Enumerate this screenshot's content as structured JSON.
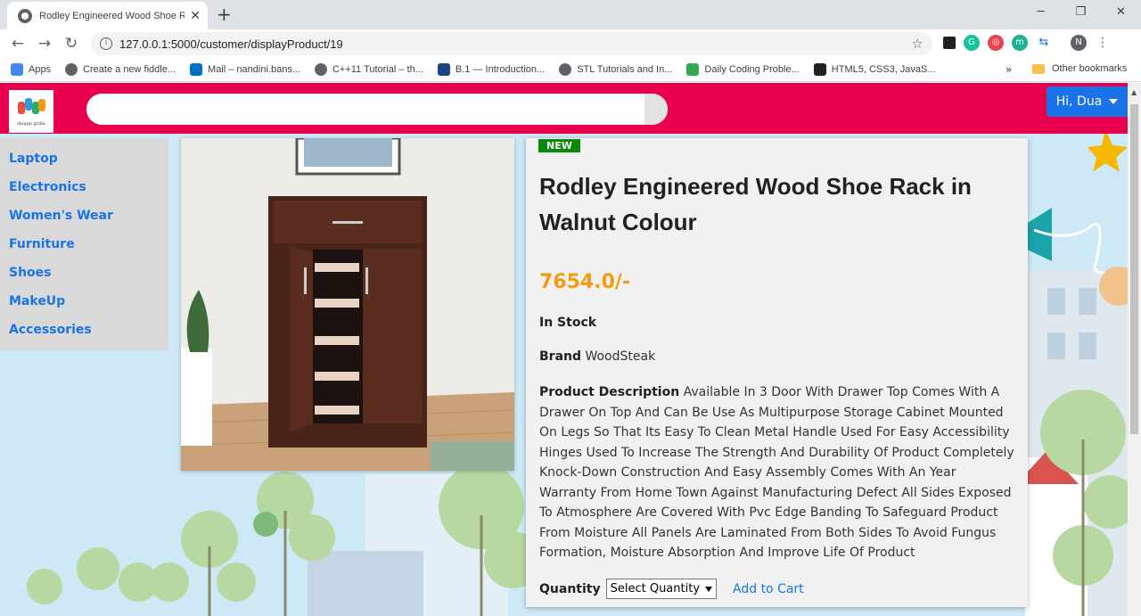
{
  "browser": {
    "tab_title": "Rodley Engineered Wood Shoe R",
    "url": "127.0.0.1:5000/customer/displayProduct/19",
    "profile_initial": "N",
    "bookmarks": [
      {
        "label": "Apps",
        "color": "#4285f4"
      },
      {
        "label": "Create a new fiddle...",
        "color": "#5f6368"
      },
      {
        "label": "Mail – nandini.bans...",
        "color": "#0072c6"
      },
      {
        "label": "C++11 Tutorial – th...",
        "color": "#5f6368"
      },
      {
        "label": "B.1 — Introduction...",
        "color": "#1c4587"
      },
      {
        "label": "STL Tutorials and In...",
        "color": "#5f6368"
      },
      {
        "label": "Daily Coding Proble...",
        "color": "#34a853"
      },
      {
        "label": "HTML5, CSS3, JavaS...",
        "color": "#202124"
      }
    ],
    "other_bookmarks": "Other bookmarks"
  },
  "header": {
    "logo_text": "shoppi grilla",
    "search_value": "",
    "user_label": "Hi, Dua"
  },
  "sidebar": {
    "items": [
      "Laptop",
      "Electronics",
      "Women's Wear",
      "Furniture",
      "Shoes",
      "MakeUp",
      "Accessories"
    ]
  },
  "product": {
    "badge": "NEW",
    "title": "Rodley Engineered Wood Shoe Rack in Walnut Colour",
    "price": "7654.0/-",
    "stock": "In Stock",
    "brand_label": "Brand",
    "brand": "WoodSteak",
    "description_label": "Product Description",
    "description": "Available In 3 Door With Drawer Top Comes With A Drawer On Top And Can Be Use As Multipurpose Storage Cabinet Mounted On Legs So That Its Easy To Clean Metal Handle Used For Easy Accessibility Hinges Used To Increase The Strength And Durability Of Product Completely Knock-Down Construction And Easy Assembly Comes With An Year Warranty From Home Town Against Manufacturing Defect All Sides Exposed To Atmosphere Are Covered With Pvc Edge Banding To Safeguard Product From Moisture All Panels Are Laminated From Both Sides To Avoid Fungus Formation, Moisture Absorption And Improve Life Of Product",
    "quantity_label": "Quantity",
    "quantity_selected": "Select Quantity",
    "add_to_cart": "Add to Cart"
  },
  "colors": {
    "header_bg": "#e8004d",
    "link_blue": "#1a73e8",
    "price_orange": "#f39c12",
    "badge_green": "#0a8a0a"
  }
}
